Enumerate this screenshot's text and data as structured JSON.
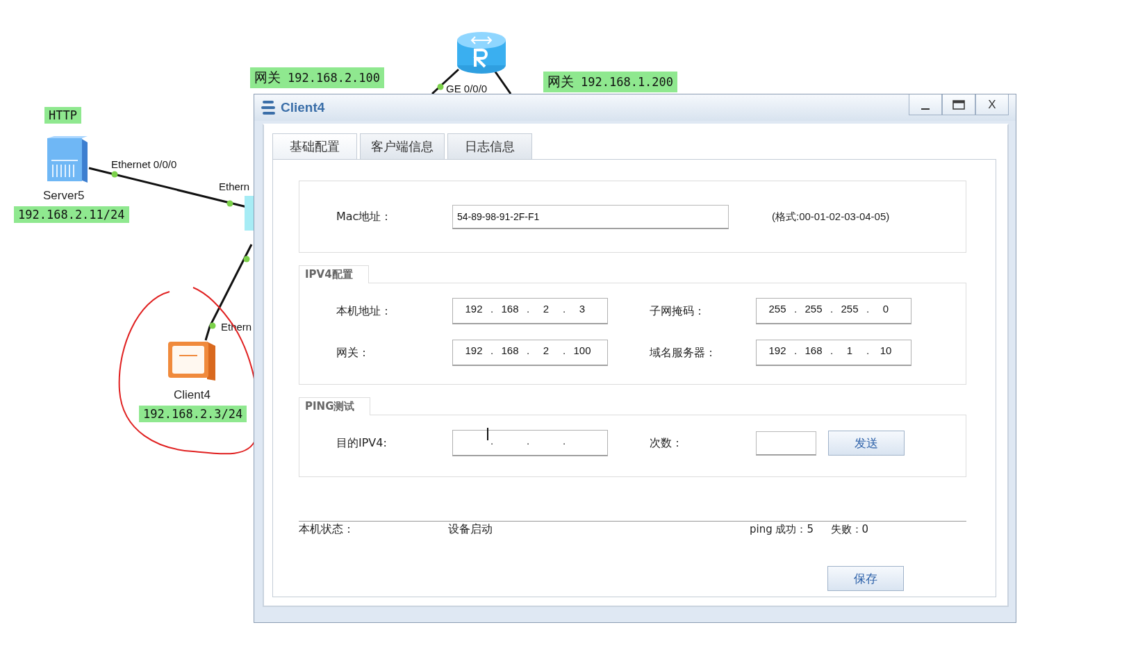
{
  "topology": {
    "notes": [
      {
        "prefix": "网关",
        "text": "192.168.2.100"
      },
      {
        "prefix": "网关",
        "text": "192.168.1.200"
      },
      {
        "text": "HTTP"
      },
      {
        "text": "192.168.2.11/24"
      },
      {
        "text": "192.168.2.3/24"
      }
    ],
    "nodes": [
      {
        "kind": "router"
      },
      {
        "kind": "server",
        "name": "Server5"
      },
      {
        "kind": "switch"
      },
      {
        "kind": "client",
        "name": "Client4"
      }
    ],
    "ports": [
      {
        "text": "GE 0/0/0"
      },
      {
        "text": "Ethernet 0/0/0"
      },
      {
        "text": "Ethern"
      },
      {
        "text": "Ethern"
      }
    ]
  },
  "window": {
    "title": "Client4",
    "close": "X",
    "tabs": [
      {
        "label": "基础配置",
        "selected": true
      },
      {
        "label": "客户端信息",
        "selected": false
      },
      {
        "label": "日志信息",
        "selected": false
      }
    ],
    "mac": {
      "label": "Mac地址：",
      "value": "54-89-98-91-2F-F1",
      "hint": "(格式:00-01-02-03-04-05)"
    },
    "ipv4": {
      "title": "IPV4配置",
      "separator": ".",
      "fields": [
        {
          "label": "本机地址：",
          "octets": [
            "192",
            "168",
            "2",
            "3"
          ]
        },
        {
          "label": "子网掩码：",
          "octets": [
            "255",
            "255",
            "255",
            "0"
          ]
        },
        {
          "label": "网关：",
          "octets": [
            "192",
            "168",
            "2",
            "100"
          ]
        },
        {
          "label": "域名服务器：",
          "octets": [
            "192",
            "168",
            "1",
            "10"
          ]
        }
      ]
    },
    "ping": {
      "title": "PING测试",
      "separator": ".",
      "target": {
        "label": "目的IPV4:",
        "focused": true
      },
      "count_label": "次数：",
      "send": "发送"
    },
    "status": {
      "label": "本机状态：",
      "value": "设备启动",
      "success_label": "ping 成功：",
      "success": "5",
      "fail_label": "失败：",
      "fail": "0"
    },
    "save": "保存"
  }
}
